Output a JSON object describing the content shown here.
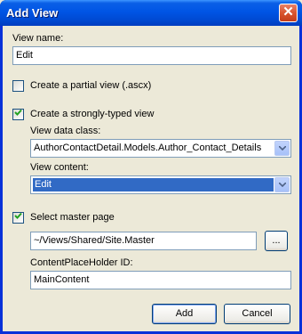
{
  "window": {
    "title": "Add View",
    "close_glyph": "✕"
  },
  "view_name": {
    "label": "View name:",
    "value": "Edit"
  },
  "partial": {
    "label": "Create a partial view (.ascx)",
    "checked": false
  },
  "strongly_typed": {
    "label": "Create a strongly-typed view",
    "checked": true,
    "data_class_label": "View data class:",
    "data_class_value": "AuthorContactDetail.Models.Author_Contact_Details",
    "content_label": "View content:",
    "content_value": "Edit"
  },
  "master": {
    "label": "Select master page",
    "checked": true,
    "path": "~/Views/Shared/Site.Master",
    "browse_label": "...",
    "placeholder_label": "ContentPlaceHolder ID:",
    "placeholder_value": "MainContent"
  },
  "buttons": {
    "add": "Add",
    "cancel": "Cancel"
  },
  "colors": {
    "title_bar": "#0055e5",
    "selection": "#316ac5",
    "dialog_bg": "#ece9d8"
  }
}
